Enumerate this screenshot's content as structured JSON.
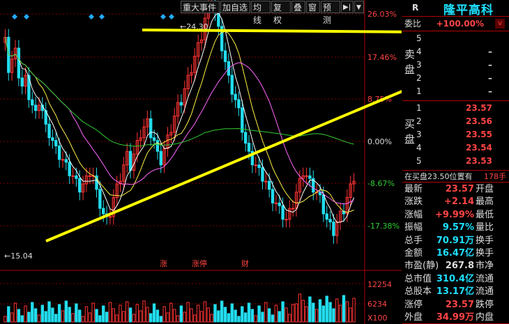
{
  "toolbar": {
    "items": [
      "重大事件",
      "加自选",
      "均线",
      "复权",
      "叠",
      "窗",
      "预测"
    ],
    "icon_expand": "▶|",
    "icon_menu": "▼"
  },
  "stock": {
    "code": "R",
    "name": "隆平高科"
  },
  "price_axis": [
    "26.03%",
    "17.46%",
    "8.75%",
    "0.00%",
    "-8.67%",
    "-17.38%"
  ],
  "volume_axis": [
    "12254",
    "6234",
    "X100"
  ],
  "price_labels": {
    "high": "24.30",
    "low": "15.04"
  },
  "event_markers": [
    "涨",
    "涨停",
    "财"
  ],
  "order_book": {
    "weibi_label": "委比",
    "weibi_value": "+100.00%",
    "sell_label": "卖盘",
    "buy_label": "买盘",
    "sell": [
      {
        "level": "5",
        "price": "",
        "vol": ""
      },
      {
        "level": "4",
        "price": "–",
        "vol": ""
      },
      {
        "level": "3",
        "price": "–",
        "vol": ""
      },
      {
        "level": "2",
        "price": "–",
        "vol": ""
      },
      {
        "level": "1",
        "price": "–",
        "vol": ""
      }
    ],
    "buy": [
      {
        "level": "1",
        "price": "23.57"
      },
      {
        "level": "2",
        "price": "23.56"
      },
      {
        "level": "3",
        "price": "23.55"
      },
      {
        "level": "4",
        "price": "23.54"
      },
      {
        "level": "5",
        "price": "23.53"
      }
    ],
    "note": "在买盘23.50位置有",
    "note_vol": "178手"
  },
  "stats": [
    {
      "label": "最新",
      "value": "23.57",
      "color": "red",
      "tail": "开盘"
    },
    {
      "label": "涨跌",
      "value": "+2.14",
      "color": "red",
      "tail": "最高"
    },
    {
      "label": "涨幅",
      "value": "+9.99%",
      "color": "red",
      "tail": "最低"
    },
    {
      "label": "振幅",
      "value": "9.57%",
      "color": "cyan",
      "tail": "量比"
    },
    {
      "label": "总手",
      "value": "70.91万",
      "color": "cyan",
      "tail": "换手"
    },
    {
      "label": "金额",
      "value": "16.47亿",
      "color": "cyan",
      "tail": "换手"
    },
    {
      "label": "市盈(静)",
      "value": "267.8",
      "color": "white",
      "tail": "市净"
    },
    {
      "label": "总市值",
      "value": "310.4亿",
      "color": "cyan",
      "tail": "流通"
    },
    {
      "label": "总股本",
      "value": "13.17亿",
      "color": "cyan",
      "tail": "流通"
    },
    {
      "label": "涨停",
      "value": "23.57",
      "color": "red",
      "tail": "跌停"
    },
    {
      "label": "外盘",
      "value": "34.99万",
      "color": "red",
      "tail": "内盘"
    }
  ],
  "colors": {
    "up": "#ff3333",
    "down": "#22ddee",
    "ma5": "#ffffff",
    "ma10": "#ffee44",
    "ma20": "#ff66ff",
    "ma60": "#33cc33",
    "arrow": "#ffff00"
  }
}
